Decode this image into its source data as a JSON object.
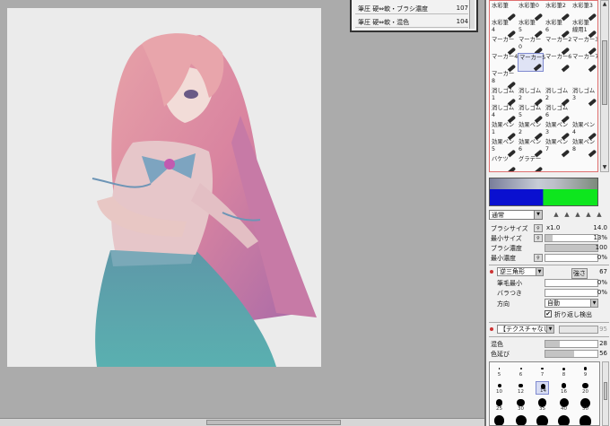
{
  "layer_panel": {
    "rows": [
      {
        "name": "筆圧 硬⇔軟・ブラシ濃度",
        "value": "107"
      },
      {
        "name": "筆圧 硬⇔軟・混色",
        "value": "104"
      }
    ]
  },
  "tools": [
    {
      "label": "水彩筆",
      "sel": false
    },
    {
      "label": "水彩筆0",
      "sel": false
    },
    {
      "label": "水彩筆2",
      "sel": false
    },
    {
      "label": "水彩筆3",
      "sel": false
    },
    {
      "label": "水彩筆\n4",
      "sel": false
    },
    {
      "label": "水彩筆\n5",
      "sel": false
    },
    {
      "label": "水彩筆\n6",
      "sel": false
    },
    {
      "label": "水彩筆\n線用1",
      "sel": false
    },
    {
      "label": "マーカー",
      "sel": false
    },
    {
      "label": "マーカー\n0",
      "sel": false
    },
    {
      "label": "マーカー2",
      "sel": false
    },
    {
      "label": "マーカー3",
      "sel": false
    },
    {
      "label": "マーカー4",
      "sel": false
    },
    {
      "label": "マーカー5",
      "sel": true
    },
    {
      "label": "マーカー6",
      "sel": false
    },
    {
      "label": "マーカー7",
      "sel": false
    },
    {
      "label": "マーカー\n8",
      "sel": false
    },
    {
      "label": "",
      "sel": false
    },
    {
      "label": "",
      "sel": false
    },
    {
      "label": "",
      "sel": false
    },
    {
      "label": "消しゴム\n1",
      "sel": false
    },
    {
      "label": "消しゴム\n2",
      "sel": false
    },
    {
      "label": "消しゴム\n2",
      "sel": false
    },
    {
      "label": "消しゴム\n3",
      "sel": false
    },
    {
      "label": "消しゴム\n4",
      "sel": false
    },
    {
      "label": "消しゴム\n5",
      "sel": false
    },
    {
      "label": "消しゴム\n6",
      "sel": false
    },
    {
      "label": "",
      "sel": false
    },
    {
      "label": "効果ペン\n1",
      "sel": false
    },
    {
      "label": "効果ペン\n2",
      "sel": false
    },
    {
      "label": "効果ペン\n3",
      "sel": false
    },
    {
      "label": "効果ペン\n4",
      "sel": false
    },
    {
      "label": "効果ペン\n5",
      "sel": false
    },
    {
      "label": "効果ペン\n6",
      "sel": false
    },
    {
      "label": "効果ペン\n7",
      "sel": false
    },
    {
      "label": "効果ペン\n8",
      "sel": false
    },
    {
      "label": "バケツ",
      "sel": false
    },
    {
      "label": "グラデー",
      "sel": false
    },
    {
      "label": "",
      "sel": false
    },
    {
      "label": "",
      "sel": false
    }
  ],
  "blend_mode": "通常",
  "brush_size": {
    "label": "ブラシサイズ",
    "mult": "x1.0",
    "value": "14.0"
  },
  "min_size": {
    "label": "最小サイズ",
    "value": "13%",
    "fill": 0.13
  },
  "brush_density": {
    "label": "ブラシ濃度",
    "value": "100",
    "fill": 1.0
  },
  "min_density": {
    "label": "最小濃度",
    "value": "0%",
    "fill": 0.0
  },
  "shape": {
    "select": "逆三角形",
    "strength_label": "強さ",
    "value": "67"
  },
  "bristle_min": {
    "label": "筆毛最小",
    "value": "0%"
  },
  "scatter": {
    "label": "バラつき",
    "value": "0%"
  },
  "direction": {
    "label": "方向",
    "select": "自動"
  },
  "fold_detect": {
    "label": "折り返し検出",
    "check": "✔"
  },
  "texture": {
    "select": "【テクスチャなし】",
    "value": "95"
  },
  "mix_color": {
    "label": "混色",
    "value": "28",
    "fill": 0.28
  },
  "blur": {
    "label": "色延び",
    "value": "56",
    "fill": 0.56
  },
  "brush_sizes": [
    {
      "label": "5",
      "size": 1.5
    },
    {
      "label": "6",
      "size": 2
    },
    {
      "label": "7",
      "size": 2.4
    },
    {
      "label": "8",
      "size": 3
    },
    {
      "label": "9",
      "size": 3.5
    },
    {
      "label": "10",
      "size": 4
    },
    {
      "label": "12",
      "size": 4.6
    },
    {
      "label": "14",
      "size": 5.2,
      "sel": true
    },
    {
      "label": "16",
      "size": 5.8
    },
    {
      "label": "20",
      "size": 6.8
    },
    {
      "label": "25",
      "size": 7.6
    },
    {
      "label": "30",
      "size": 8.4
    },
    {
      "label": "35",
      "size": 9.2
    },
    {
      "label": "40",
      "size": 10
    },
    {
      "label": "50",
      "size": 11
    },
    {
      "label": "",
      "size": 11.5
    },
    {
      "label": "",
      "size": 12
    },
    {
      "label": "",
      "size": 12.5
    },
    {
      "label": "",
      "size": 13
    },
    {
      "label": "",
      "size": 13.5
    }
  ],
  "colors": {
    "primary": "#0a10d0",
    "secondary": "#0ee61e",
    "selection_accent": "#7f8ad0",
    "tool_border": "#e07070"
  },
  "icons": {
    "dropdown": "▼",
    "up_arrow": "▲",
    "down_arrow": "▼",
    "mult_toggle": "⚲"
  }
}
